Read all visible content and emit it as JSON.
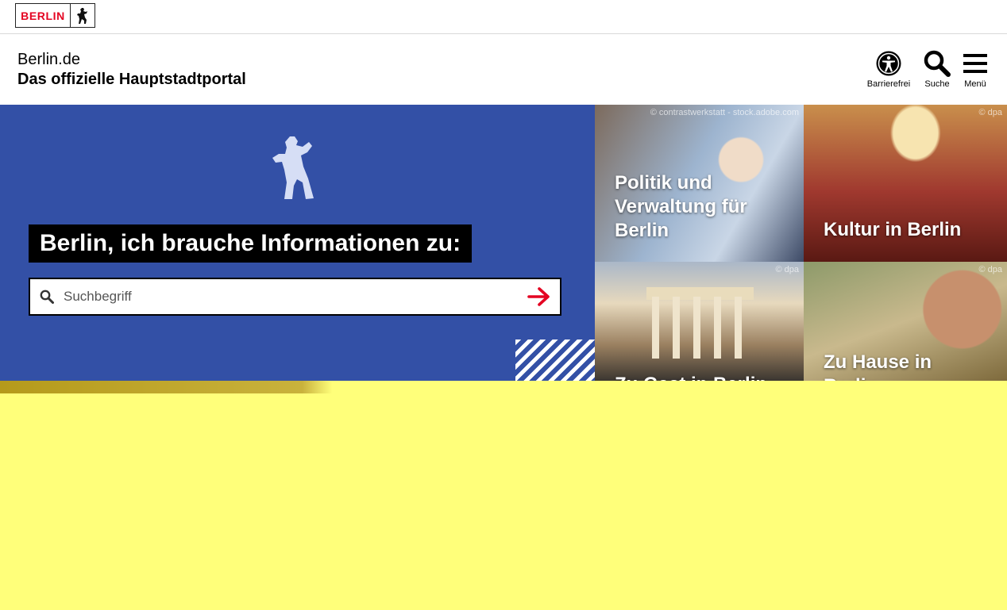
{
  "logo": {
    "text": "BERLIN"
  },
  "header": {
    "site_name": "Berlin.de",
    "site_claim": "Das offizielle Hauptstadtportal",
    "buttons": {
      "barrierefrei": "Barrierefrei",
      "suche": "Suche",
      "menu": "Menü"
    }
  },
  "hero": {
    "heading": "Berlin, ich brauche Informationen zu:",
    "search_placeholder": "Suchbegriff"
  },
  "tiles": [
    {
      "title": "Politik und Verwaltung für Berlin",
      "credit": "© contrastwerkstatt - stock.adobe.com"
    },
    {
      "title": "Kultur in Berlin",
      "credit": "© dpa"
    },
    {
      "title": "Zu Gast in Berlin",
      "credit": "© dpa"
    },
    {
      "title": "Zu Hause in Berlin",
      "credit": "© dpa"
    }
  ],
  "colors": {
    "brand_red": "#e40422",
    "hero_blue": "#3350a6",
    "background": "#ffff7a"
  }
}
